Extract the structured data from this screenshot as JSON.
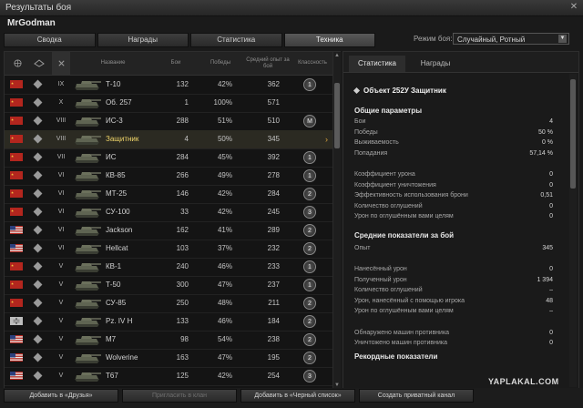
{
  "window": {
    "title": "Результаты боя",
    "close_glyph": "✕"
  },
  "player_name": "MrGodman",
  "tabs": [
    {
      "label": "Сводка"
    },
    {
      "label": "Награды"
    },
    {
      "label": "Статистика"
    },
    {
      "label": "Техника",
      "active": true
    }
  ],
  "battle_mode": {
    "label": "Режим боя:",
    "value": "Случайный, Ротный"
  },
  "table": {
    "headers": {
      "name": "Название",
      "battles": "Бои",
      "wins": "Победы",
      "avg_exp": "Средний опыт за бой",
      "mastery": "Классность"
    },
    "rows": [
      {
        "nation": "ussr",
        "tier": "IX",
        "name": "Т-10",
        "battles": "132",
        "wins": "42%",
        "exp": "362",
        "badge": "1"
      },
      {
        "nation": "ussr",
        "tier": "X",
        "name": "Об. 257",
        "battles": "1",
        "wins": "100%",
        "exp": "571",
        "badge": ""
      },
      {
        "nation": "ussr",
        "tier": "VIII",
        "name": "ИС-3",
        "battles": "288",
        "wins": "51%",
        "exp": "510",
        "badge": "M"
      },
      {
        "nation": "ussr",
        "tier": "VIII",
        "name": "Защитник",
        "battles": "4",
        "wins": "50%",
        "exp": "345",
        "badge": "",
        "selected": true
      },
      {
        "nation": "ussr",
        "tier": "VII",
        "name": "ИС",
        "battles": "284",
        "wins": "45%",
        "exp": "392",
        "badge": "1"
      },
      {
        "nation": "ussr",
        "tier": "VI",
        "name": "КВ-85",
        "battles": "266",
        "wins": "49%",
        "exp": "278",
        "badge": "1"
      },
      {
        "nation": "ussr",
        "tier": "VI",
        "name": "МТ-25",
        "battles": "146",
        "wins": "42%",
        "exp": "284",
        "badge": "2"
      },
      {
        "nation": "ussr",
        "tier": "VI",
        "name": "СУ-100",
        "battles": "33",
        "wins": "42%",
        "exp": "245",
        "badge": "3"
      },
      {
        "nation": "usa",
        "tier": "VI",
        "name": "Jackson",
        "battles": "162",
        "wins": "41%",
        "exp": "289",
        "badge": "2"
      },
      {
        "nation": "usa",
        "tier": "VI",
        "name": "Hellcat",
        "battles": "103",
        "wins": "37%",
        "exp": "232",
        "badge": "2"
      },
      {
        "nation": "ussr",
        "tier": "V",
        "name": "КВ-1",
        "battles": "240",
        "wins": "46%",
        "exp": "233",
        "badge": "1"
      },
      {
        "nation": "ussr",
        "tier": "V",
        "name": "Т-50",
        "battles": "300",
        "wins": "47%",
        "exp": "237",
        "badge": "1"
      },
      {
        "nation": "ussr",
        "tier": "V",
        "name": "СУ-85",
        "battles": "250",
        "wins": "48%",
        "exp": "211",
        "badge": "2"
      },
      {
        "nation": "germany",
        "tier": "V",
        "name": "Pz. IV H",
        "battles": "133",
        "wins": "46%",
        "exp": "184",
        "badge": "2"
      },
      {
        "nation": "usa",
        "tier": "V",
        "name": "M7",
        "battles": "98",
        "wins": "54%",
        "exp": "238",
        "badge": "2"
      },
      {
        "nation": "usa",
        "tier": "V",
        "name": "Wolverine",
        "battles": "163",
        "wins": "47%",
        "exp": "195",
        "badge": "2"
      },
      {
        "nation": "usa",
        "tier": "V",
        "name": "T67",
        "battles": "125",
        "wins": "42%",
        "exp": "254",
        "badge": "3"
      }
    ]
  },
  "detail": {
    "tabs": [
      {
        "label": "Статистика",
        "active": true
      },
      {
        "label": "Награды"
      }
    ],
    "vehicle_title": "Объект 252У Защитник",
    "general": {
      "title": "Общие параметры",
      "rows": [
        {
          "label": "Бои",
          "value": "4"
        },
        {
          "label": "Победы",
          "value": "50 %"
        },
        {
          "label": "Выживаемость",
          "value": "0 %"
        },
        {
          "label": "Попадания",
          "value": "57,14 %"
        }
      ]
    },
    "ratios": [
      {
        "label": "Коэффициент урона",
        "value": "0"
      },
      {
        "label": "Коэффициент уничтожения",
        "value": "0"
      },
      {
        "label": "Эффективность использования брони",
        "value": "0,51"
      },
      {
        "label": "Количество оглушений",
        "value": "0"
      },
      {
        "label": "Урон по оглушённым вами целям",
        "value": "0"
      }
    ],
    "averages": {
      "title": "Средние показатели за бой",
      "rows": [
        {
          "label": "Опыт",
          "value": "345"
        }
      ]
    },
    "damage": [
      {
        "label": "Нанесённый урон",
        "value": "0"
      },
      {
        "label": "Полученный урон",
        "value": "1 394"
      },
      {
        "label": "Количество оглушений",
        "value": "–"
      },
      {
        "label": "Урон, нанесённый с помощью игрока",
        "value": "48"
      },
      {
        "label": "Урон по оглушённым вами целям",
        "value": "–"
      }
    ],
    "spotting": [
      {
        "label": "Обнаружено машин противника",
        "value": "0"
      },
      {
        "label": "Уничтожено машин противника",
        "value": "0"
      }
    ],
    "records_title": "Рекордные показатели"
  },
  "bottom_buttons": [
    {
      "label": "Добавить в «Друзья»"
    },
    {
      "label": "Пригласить в клан",
      "disabled": true
    },
    {
      "label": "Добавить в «Черный список»"
    },
    {
      "label": "Создать приватный канал"
    }
  ],
  "watermark": "YAPLAKAL.COM",
  "colors": {
    "highlight": "#f2d76a",
    "accent": "#d9a33c"
  }
}
